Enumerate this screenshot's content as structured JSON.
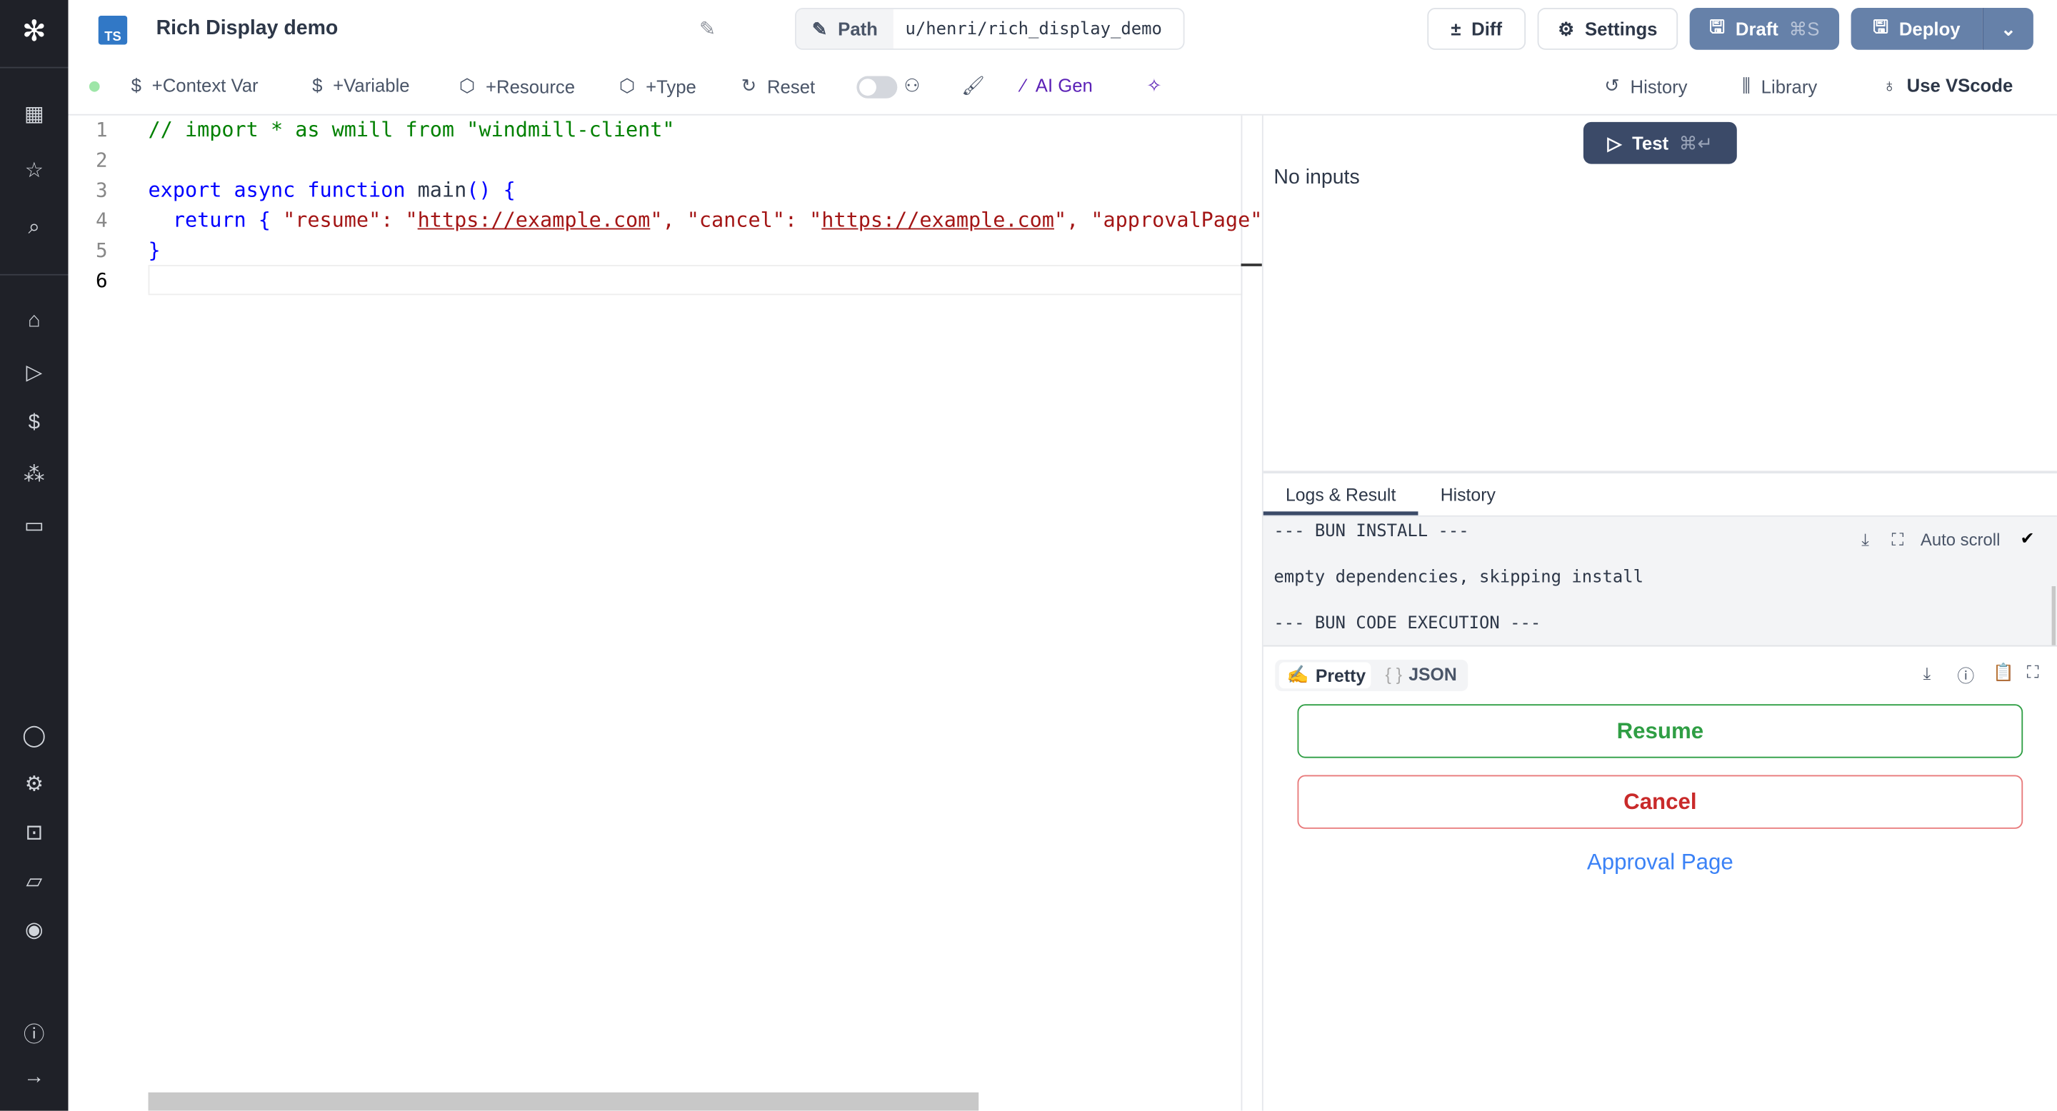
{
  "header": {
    "title": "Rich Display demo",
    "lang_badge": "TS",
    "path_label": "Path",
    "path_value": "u/henri/rich_display_demo",
    "buttons": {
      "diff": "Diff",
      "settings": "Settings",
      "draft": "Draft",
      "draft_shortcut": "⌘S",
      "deploy": "Deploy"
    }
  },
  "toolbar": {
    "items": [
      "+Context Var",
      "+Variable",
      "+Resource",
      "+Type",
      "Reset",
      "AI Gen"
    ],
    "right": [
      "History",
      "Library",
      "Use VScode"
    ],
    "status_color": "#9ee6a8",
    "ai_color": "#5b21b6"
  },
  "editor": {
    "line_numbers": [
      "1",
      "2",
      "3",
      "4",
      "5",
      "6"
    ],
    "lines": {
      "l1": "// import * as wmill from \"windmill-client\"",
      "l3a": "export async function ",
      "l3b": "main",
      "l3c": "() {",
      "l4a": "  return { ",
      "l4b": "\"resume\"",
      "l4c": ": \"",
      "l4d": "https://example.com",
      "l4e": "\", ",
      "l4f": "\"cancel\"",
      "l4g": ": \"",
      "l4h": "https://example.com",
      "l4i": "\", ",
      "l4j": "\"approvalPage\"",
      "l4k": ":",
      "l5": "}"
    }
  },
  "panel": {
    "test_label": "Test",
    "test_shortcut": "⌘↵",
    "no_inputs": "No inputs",
    "tabs": [
      "Logs & Result",
      "History"
    ],
    "logs": [
      "--- BUN INSTALL ---",
      "empty dependencies, skipping install",
      "--- BUN CODE EXECUTION ---"
    ],
    "auto_scroll": "Auto scroll",
    "auto_scroll_checked": true,
    "view_tabs": [
      "Pretty",
      "JSON"
    ],
    "result": {
      "resume": "Resume",
      "cancel": "Cancel",
      "approval": "Approval Page"
    },
    "colors": {
      "resume": "#2f9e44",
      "cancel": "#c92a2a",
      "link": "#3b82f6",
      "primary": "#3b4a68"
    }
  }
}
